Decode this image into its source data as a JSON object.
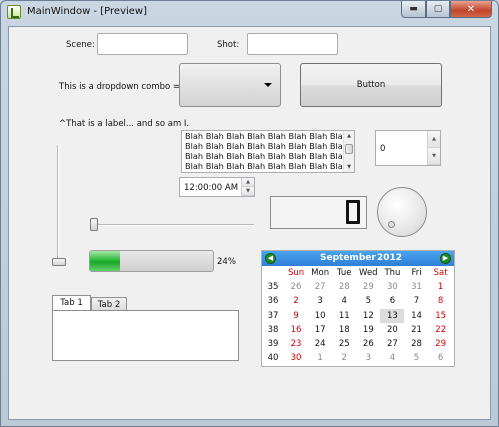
{
  "window": {
    "title": "MainWindow - [Preview]",
    "minimize_glyph": "▬",
    "maximize_glyph": "▢",
    "close_glyph": "✕"
  },
  "form": {
    "scene_label": "Scene:",
    "scene_value": "",
    "shot_label": "Shot:",
    "shot_value": "",
    "combo_label": "This is a dropdown combo =>",
    "combo_value": "",
    "button_label": "Button",
    "caption_label": "^That is a label... and so am I."
  },
  "listbox": {
    "rows": [
      "Blah Blah Blah Blah Blah Blah Blah Blah",
      "Blah Blah Blah Blah Blah Blah Blah Blah",
      "Blah Blah Blah Blah Blah Blah Blah Blah",
      "Blah Blah Blah Blah Blah Blah Blah Blah"
    ]
  },
  "spinbox": {
    "value": "0"
  },
  "timeedit": {
    "value": "12:00:00 AM"
  },
  "lcd": {
    "value": "0"
  },
  "progress": {
    "value": 24,
    "text": "24%"
  },
  "sliders": {
    "vertical_value": 0,
    "horizontal_value": 0
  },
  "tabs": [
    {
      "label": "Tab 1",
      "active": true
    },
    {
      "label": "Tab 2",
      "active": false
    }
  ],
  "calendar": {
    "month": "September",
    "year": "2012",
    "weekdays": [
      "Sun",
      "Mon",
      "Tue",
      "Wed",
      "Thu",
      "Fri",
      "Sat"
    ],
    "weeks": [
      {
        "week": "35",
        "days": [
          "26",
          "27",
          "28",
          "29",
          "30",
          "31",
          "1"
        ]
      },
      {
        "week": "36",
        "days": [
          "2",
          "3",
          "4",
          "5",
          "6",
          "7",
          "8"
        ]
      },
      {
        "week": "37",
        "days": [
          "9",
          "10",
          "11",
          "12",
          "13",
          "14",
          "15"
        ]
      },
      {
        "week": "38",
        "days": [
          "16",
          "17",
          "18",
          "19",
          "20",
          "21",
          "22"
        ]
      },
      {
        "week": "39",
        "days": [
          "23",
          "24",
          "25",
          "26",
          "27",
          "28",
          "29"
        ]
      },
      {
        "week": "40",
        "days": [
          "30",
          "1",
          "2",
          "3",
          "4",
          "5",
          "6"
        ]
      }
    ],
    "selected_day": "13",
    "colors": {
      "header": "#2e7fd8",
      "weekend": "#d40000",
      "other_month": "#8a8a8a",
      "nav": "#1f8a2c"
    }
  }
}
